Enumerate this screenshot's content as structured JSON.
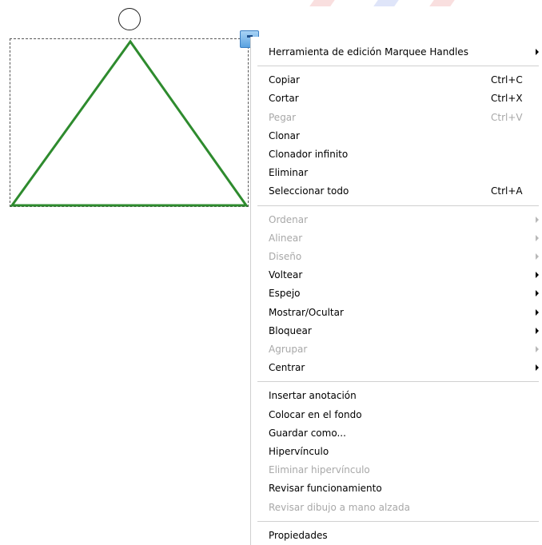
{
  "colors": {
    "shape_stroke": "#2e8b2e",
    "disabled_text": "#a8a8a8",
    "menu_handle": "#5aa2e0"
  },
  "canvas": {
    "shape": "triangle",
    "rotate_handle_icon": "circle-rotate-icon",
    "menu_handle_icon": "menu-handle-icon"
  },
  "context_menu": {
    "groups": [
      [
        {
          "label": "Herramienta de edición Marquee Handles",
          "shortcut": "",
          "submenu": true,
          "disabled": false
        }
      ],
      [
        {
          "label": "Copiar",
          "shortcut": "Ctrl+C",
          "submenu": false,
          "disabled": false
        },
        {
          "label": "Cortar",
          "shortcut": "Ctrl+X",
          "submenu": false,
          "disabled": false
        },
        {
          "label": "Pegar",
          "shortcut": "Ctrl+V",
          "submenu": false,
          "disabled": true
        },
        {
          "label": "Clonar",
          "shortcut": "",
          "submenu": false,
          "disabled": false
        },
        {
          "label": "Clonador infinito",
          "shortcut": "",
          "submenu": false,
          "disabled": false
        },
        {
          "label": "Eliminar",
          "shortcut": "",
          "submenu": false,
          "disabled": false
        },
        {
          "label": "Seleccionar todo",
          "shortcut": "Ctrl+A",
          "submenu": false,
          "disabled": false
        }
      ],
      [
        {
          "label": "Ordenar",
          "shortcut": "",
          "submenu": true,
          "disabled": true
        },
        {
          "label": "Alinear",
          "shortcut": "",
          "submenu": true,
          "disabled": true
        },
        {
          "label": "Diseño",
          "shortcut": "",
          "submenu": true,
          "disabled": true
        },
        {
          "label": "Voltear",
          "shortcut": "",
          "submenu": true,
          "disabled": false
        },
        {
          "label": "Espejo",
          "shortcut": "",
          "submenu": true,
          "disabled": false
        },
        {
          "label": "Mostrar/Ocultar",
          "shortcut": "",
          "submenu": true,
          "disabled": false
        },
        {
          "label": "Bloquear",
          "shortcut": "",
          "submenu": true,
          "disabled": false
        },
        {
          "label": "Agrupar",
          "shortcut": "",
          "submenu": true,
          "disabled": true
        },
        {
          "label": "Centrar",
          "shortcut": "",
          "submenu": true,
          "disabled": false
        }
      ],
      [
        {
          "label": "Insertar anotación",
          "shortcut": "",
          "submenu": false,
          "disabled": false
        },
        {
          "label": "Colocar en el fondo",
          "shortcut": "",
          "submenu": false,
          "disabled": false
        },
        {
          "label": "Guardar como...",
          "shortcut": "",
          "submenu": false,
          "disabled": false
        },
        {
          "label": "Hipervínculo",
          "shortcut": "",
          "submenu": false,
          "disabled": false
        },
        {
          "label": "Eliminar hipervínculo",
          "shortcut": "",
          "submenu": false,
          "disabled": true
        },
        {
          "label": "Revisar funcionamiento",
          "shortcut": "",
          "submenu": false,
          "disabled": false
        },
        {
          "label": "Revisar dibujo a mano alzada",
          "shortcut": "",
          "submenu": false,
          "disabled": true
        }
      ],
      [
        {
          "label": "Propiedades",
          "shortcut": "",
          "submenu": false,
          "disabled": false
        }
      ]
    ]
  }
}
